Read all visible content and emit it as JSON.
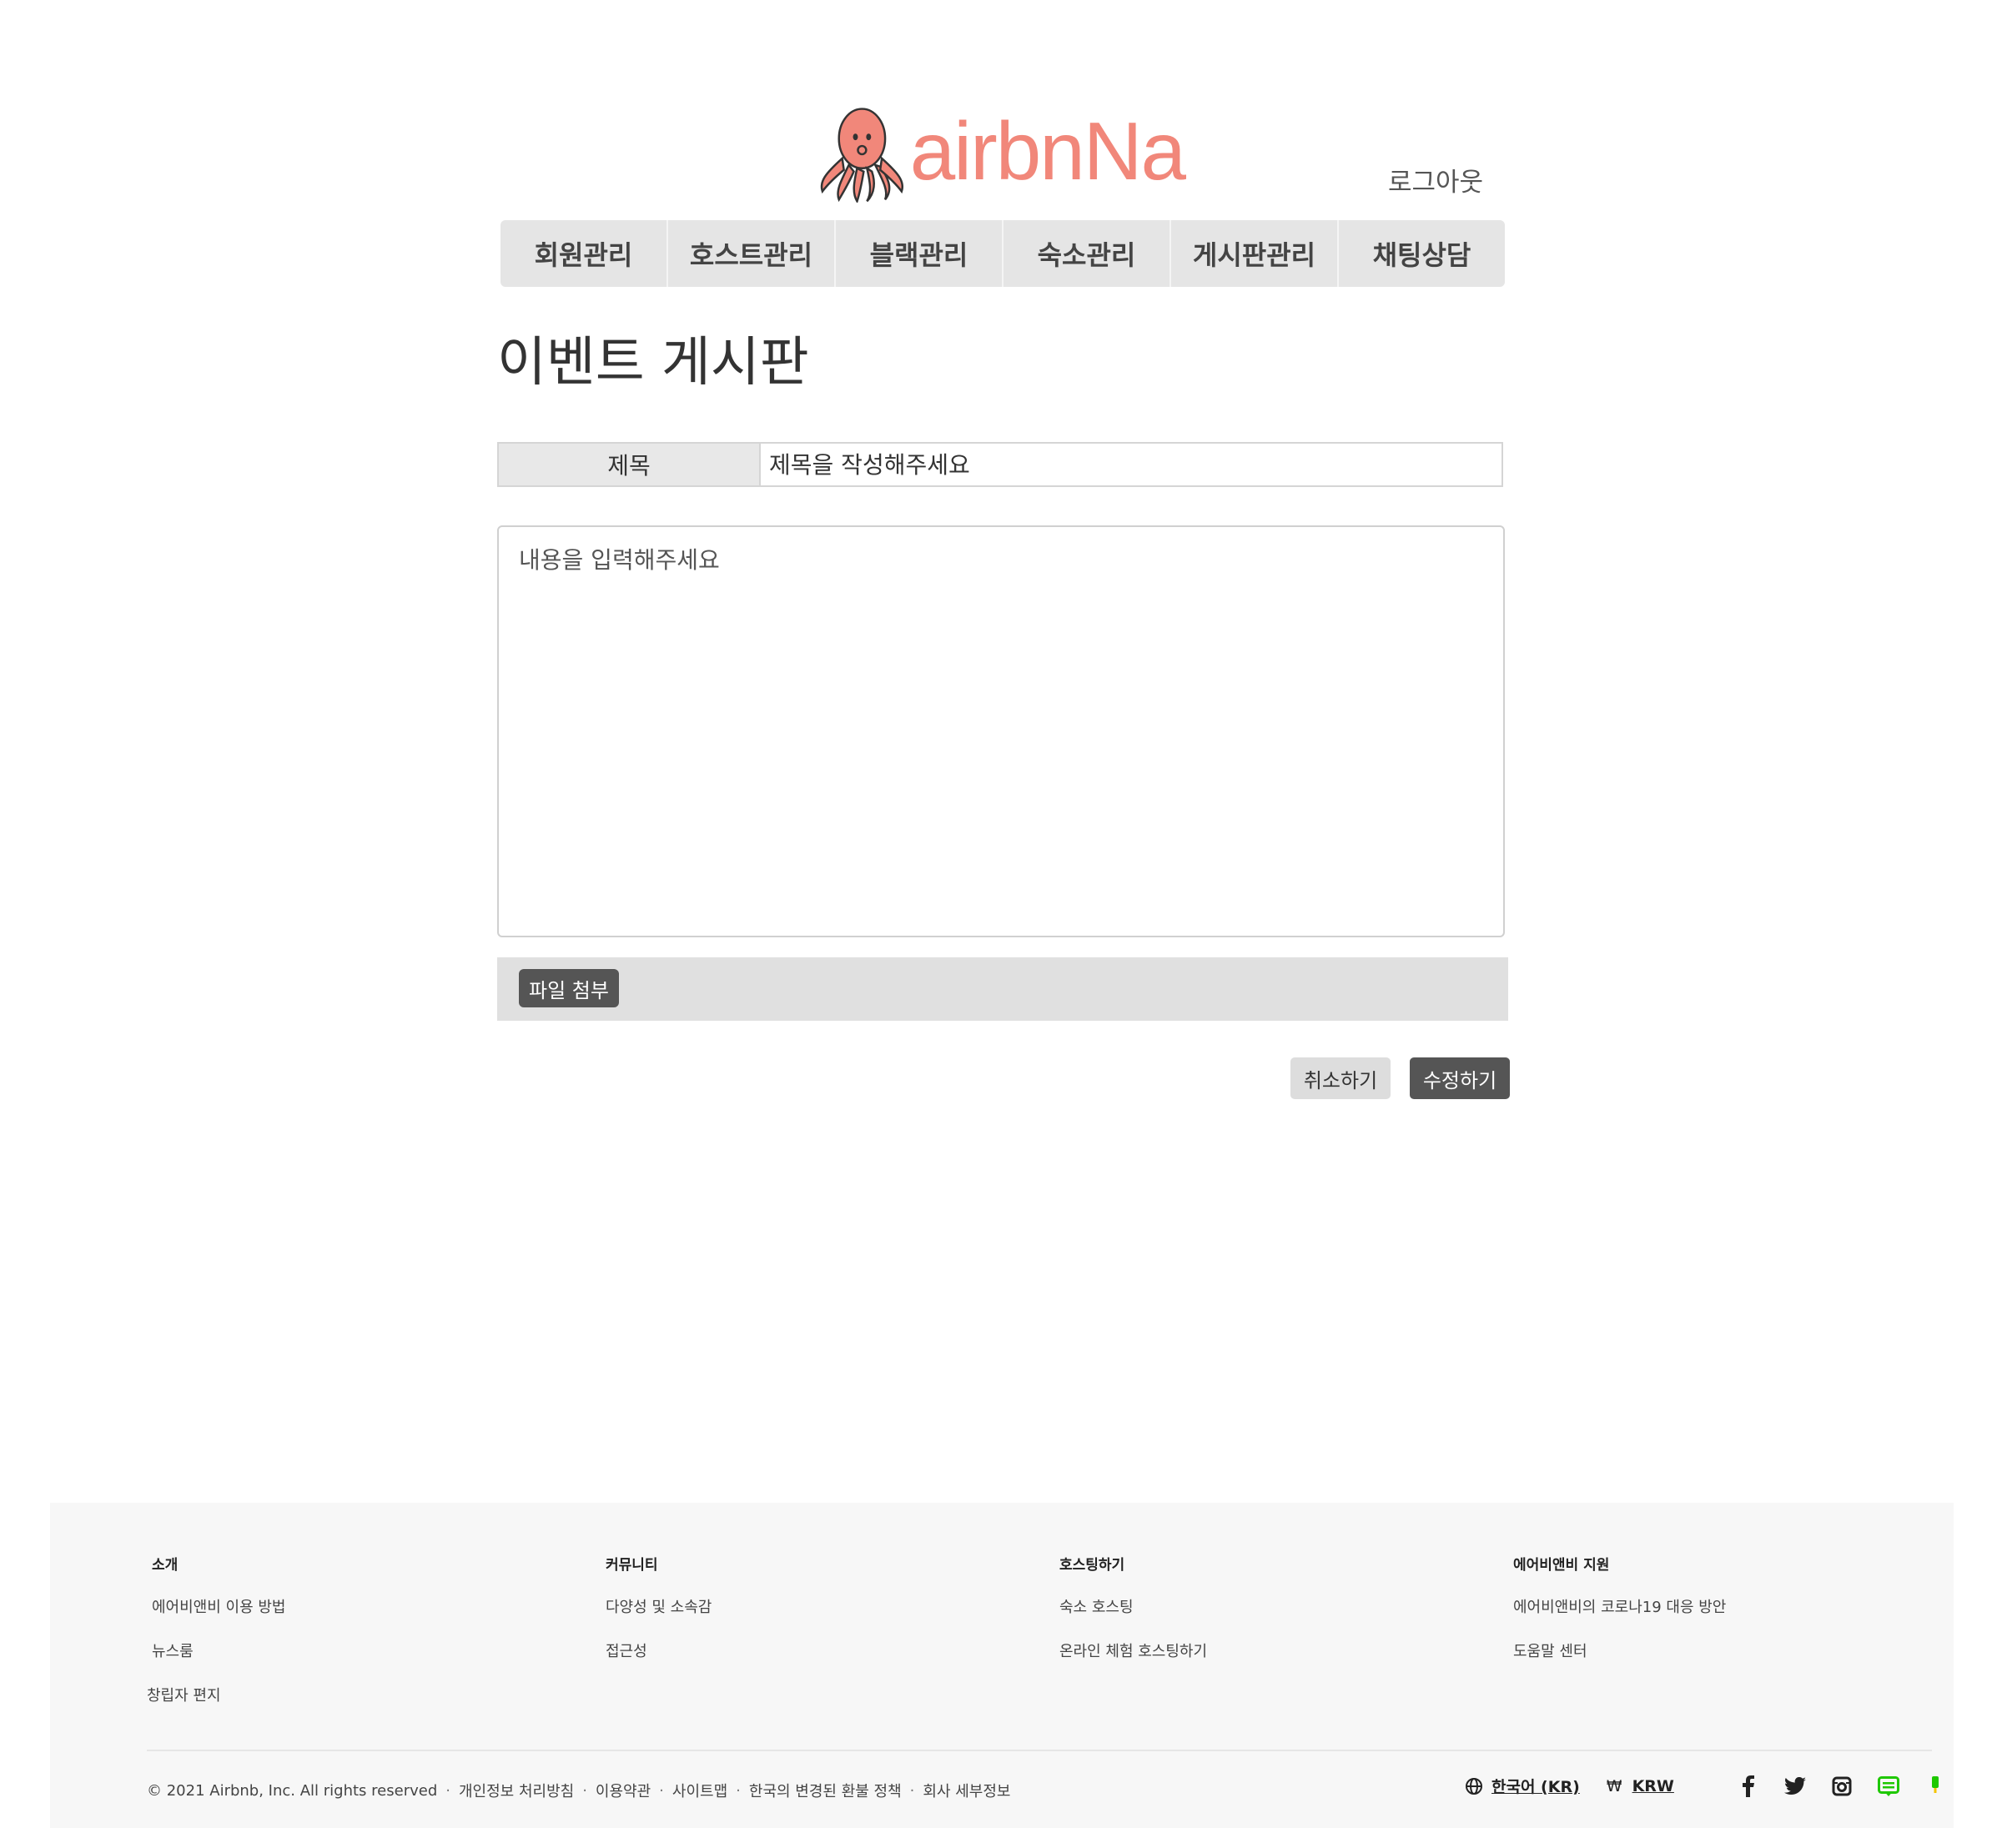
{
  "header": {
    "logo_text": "airbnNa",
    "logout_label": "로그아웃"
  },
  "nav": {
    "items": [
      "회원관리",
      "호스트관리",
      "블랙관리",
      "숙소관리",
      "게시판관리",
      "채팅상담"
    ]
  },
  "page": {
    "title": "이벤트 게시판"
  },
  "form": {
    "title_label": "제목",
    "title_placeholder": "제목을 작성해주세요",
    "content_placeholder": "내용을 입력해주세요",
    "attach_label": "파일 첨부",
    "cancel_label": "취소하기",
    "submit_label": "수정하기"
  },
  "footer": {
    "columns": [
      {
        "heading": "소개",
        "links": [
          "에어비앤비 이용 방법",
          "뉴스룸",
          "창립자 편지"
        ]
      },
      {
        "heading": "커뮤니티",
        "links": [
          "다양성 및 소속감",
          "접근성"
        ]
      },
      {
        "heading": "호스팅하기",
        "links": [
          "숙소 호스팅",
          "온라인 체험 호스팅하기"
        ]
      },
      {
        "heading": "에어비앤비 지원",
        "links": [
          "에어비앤비의 코로나19 대응 방안",
          "도움말 센터"
        ]
      }
    ],
    "copyright": "© 2021 Airbnb, Inc. All rights reserved",
    "separator": "·",
    "bottom_links": [
      "개인정보 처리방침",
      "이용약관",
      "사이트맵",
      "한국의 변경된 환불 정책",
      "회사 세부정보"
    ],
    "language": "한국어 (KR)",
    "currency_symbol": "₩",
    "currency": "KRW",
    "social_icons": [
      "facebook-icon",
      "twitter-icon",
      "instagram-icon",
      "naver-blog-icon",
      "naver-post-icon"
    ]
  },
  "colors": {
    "brand": "#f1877a",
    "nav_bg": "#e5e5e5",
    "dark_button": "#555555",
    "light_button": "#dddddd",
    "footer_bg": "#f7f7f7"
  }
}
